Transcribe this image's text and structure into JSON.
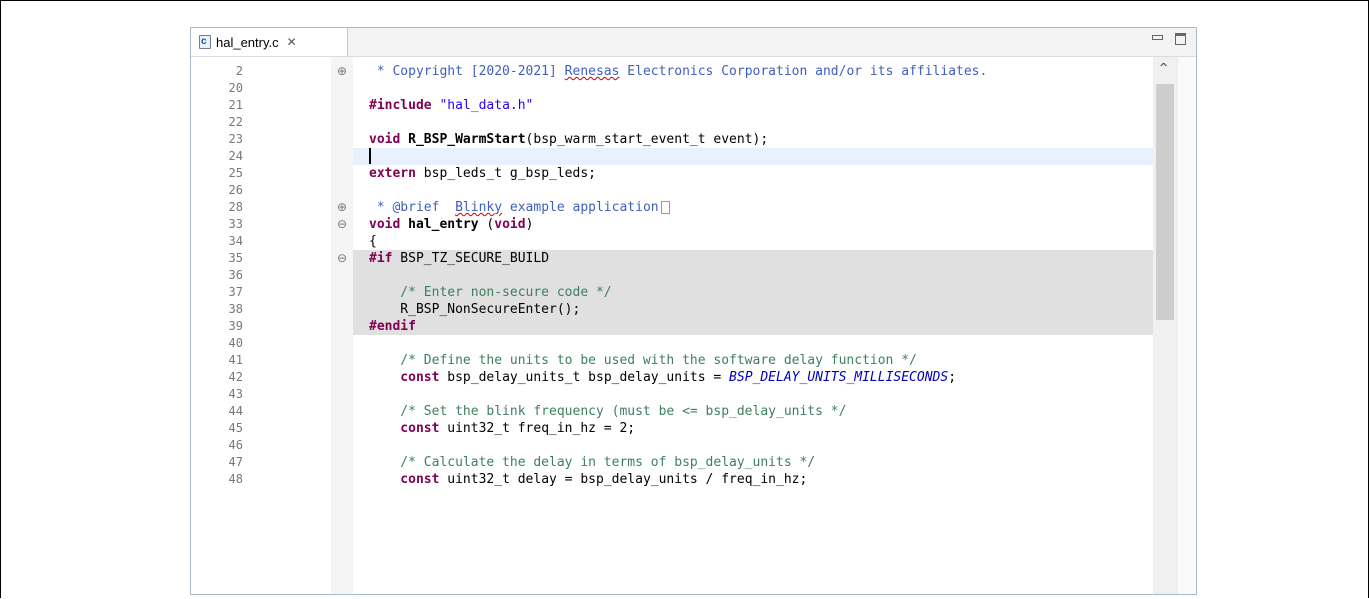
{
  "tab": {
    "label": "hal_entry.c",
    "close_glyph": "✕",
    "icon_letter": "c"
  },
  "window_buttons": [
    "minimize-icon",
    "maximize-icon"
  ],
  "lines": [
    {
      "num": "2",
      "fold": "⊕",
      "cls": "",
      "parts": [
        {
          "t": "cdoc",
          "v": " * Copyright [2020-2021] "
        },
        {
          "t": "cdoc squig",
          "v": "Renesas"
        },
        {
          "t": "cdoc",
          "v": " Electronics Corporation and/or its affiliates."
        }
      ]
    },
    {
      "num": "20",
      "parts": []
    },
    {
      "num": "21",
      "parts": [
        {
          "t": "kw",
          "v": "#include"
        },
        {
          "t": "",
          "v": " "
        },
        {
          "t": "str",
          "v": "\"hal_data.h\""
        }
      ]
    },
    {
      "num": "22",
      "parts": []
    },
    {
      "num": "23",
      "parts": [
        {
          "t": "kw",
          "v": "void"
        },
        {
          "t": "",
          "v": " "
        },
        {
          "t": "fn",
          "v": "R_BSP_WarmStart"
        },
        {
          "t": "",
          "v": "(bsp_warm_start_event_t event);"
        }
      ]
    },
    {
      "num": "24",
      "cls": "hl-current",
      "caret": true,
      "parts": []
    },
    {
      "num": "25",
      "parts": [
        {
          "t": "kw",
          "v": "extern"
        },
        {
          "t": "",
          "v": " bsp_leds_t g_bsp_leds;"
        }
      ]
    },
    {
      "num": "26",
      "parts": []
    },
    {
      "num": "28",
      "fold": "⊕",
      "ellipsis": true,
      "parts": [
        {
          "t": "cdoc",
          "v": " * @brief  "
        },
        {
          "t": "cdoc squig",
          "v": "Blinky"
        },
        {
          "t": "cdoc",
          "v": " example application"
        }
      ]
    },
    {
      "num": "33",
      "fold": "⊖",
      "parts": [
        {
          "t": "kw",
          "v": "void"
        },
        {
          "t": "",
          "v": " "
        },
        {
          "t": "fn",
          "v": "hal_entry"
        },
        {
          "t": "",
          "v": " ("
        },
        {
          "t": "kw",
          "v": "void"
        },
        {
          "t": "",
          "v": ")"
        }
      ]
    },
    {
      "num": "34",
      "parts": [
        {
          "t": "",
          "v": "{"
        }
      ]
    },
    {
      "num": "35",
      "fold": "⊖",
      "cls": "hl-inactive",
      "parts": [
        {
          "t": "kw",
          "v": "#if"
        },
        {
          "t": "",
          "v": " BSP_TZ_SECURE_BUILD"
        }
      ]
    },
    {
      "num": "36",
      "cls": "hl-inactive",
      "parts": []
    },
    {
      "num": "37",
      "cls": "hl-inactive",
      "parts": [
        {
          "t": "cmt",
          "v": "    /* Enter non-secure code */"
        }
      ]
    },
    {
      "num": "38",
      "cls": "hl-inactive",
      "parts": [
        {
          "t": "",
          "v": "    R_BSP_NonSecureEnter();"
        }
      ]
    },
    {
      "num": "39",
      "cls": "hl-inactive",
      "parts": [
        {
          "t": "kw",
          "v": "#endif"
        }
      ]
    },
    {
      "num": "40",
      "parts": []
    },
    {
      "num": "41",
      "parts": [
        {
          "t": "cmt",
          "v": "    /* Define the units to be used with the software delay function */"
        }
      ]
    },
    {
      "num": "42",
      "parts": [
        {
          "t": "kw",
          "v": "    const"
        },
        {
          "t": "",
          "v": " bsp_delay_units_t bsp_delay_units = "
        },
        {
          "t": "enum",
          "v": "BSP_DELAY_UNITS_MILLISECONDS"
        },
        {
          "t": "",
          "v": ";"
        }
      ]
    },
    {
      "num": "43",
      "parts": []
    },
    {
      "num": "44",
      "parts": [
        {
          "t": "cmt",
          "v": "    /* Set the blink frequency (must be <= bsp_delay_units */"
        }
      ]
    },
    {
      "num": "45",
      "parts": [
        {
          "t": "kw",
          "v": "    const"
        },
        {
          "t": "",
          "v": " uint32_t freq_in_hz = 2;"
        }
      ]
    },
    {
      "num": "46",
      "parts": []
    },
    {
      "num": "47",
      "parts": [
        {
          "t": "cmt",
          "v": "    /* Calculate the delay in terms of bsp_delay_units */"
        }
      ]
    },
    {
      "num": "48",
      "parts": [
        {
          "t": "kw",
          "v": "    const"
        },
        {
          "t": "",
          "v": " uint32_t delay = bsp_delay_units / freq_in_hz;"
        }
      ]
    }
  ],
  "scrollbar": {
    "up_glyph": "^",
    "thumb_fraction": 0.44
  }
}
